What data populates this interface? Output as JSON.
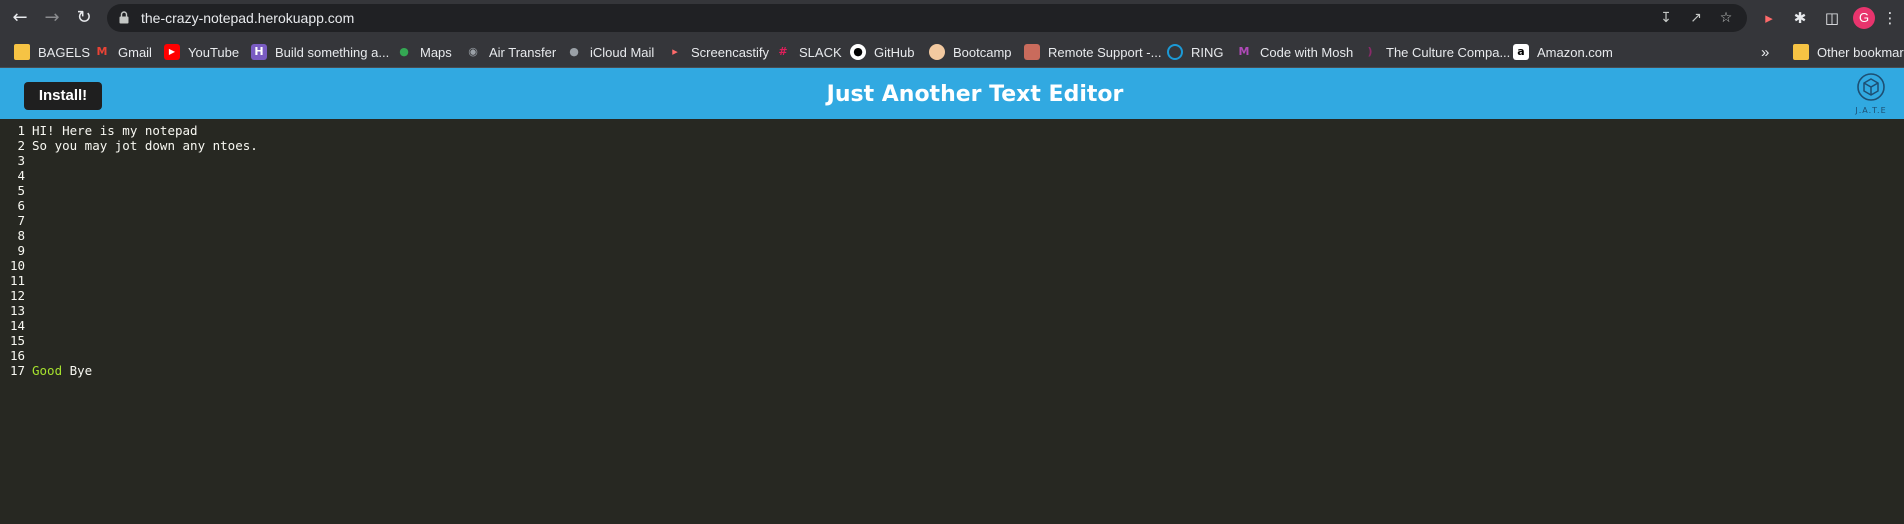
{
  "browser": {
    "url": "the-crazy-notepad.herokuapp.com",
    "avatar_letter": "G",
    "bookmarks": [
      {
        "label": "BAGELS",
        "icon": "folder-icon",
        "color": "#f6c344"
      },
      {
        "label": "Gmail",
        "icon": "gmail-icon",
        "color": "#ea4335"
      },
      {
        "label": "YouTube",
        "icon": "youtube-icon",
        "color": "#ff0000"
      },
      {
        "label": "Build something a...",
        "icon": "heroku-icon",
        "color": "#7a5cc2"
      },
      {
        "label": "Maps",
        "icon": "maps-icon",
        "color": "#34a853"
      },
      {
        "label": "Air Transfer",
        "icon": "globe-icon",
        "color": "#9aa0a6"
      },
      {
        "label": "iCloud Mail",
        "icon": "apple-icon",
        "color": "#9aa0a6"
      },
      {
        "label": "Screencastify",
        "icon": "screencastify-icon",
        "color": "#ff6a6a"
      },
      {
        "label": "SLACK",
        "icon": "slack-icon",
        "color": "#e01e5a"
      },
      {
        "label": "GitHub",
        "icon": "github-icon",
        "color": "#ffffff"
      },
      {
        "label": "Bootcamp",
        "icon": "bootcamp-icon",
        "color": "#f2c9a0"
      },
      {
        "label": "Remote Support -...",
        "icon": "remote-support-icon",
        "color": "#c96b5c"
      },
      {
        "label": "RING",
        "icon": "ring-icon",
        "color": "#1c9ad6"
      },
      {
        "label": "Code with Mosh",
        "icon": "mosh-icon",
        "color": "#b04ab8"
      },
      {
        "label": "The Culture Compa...",
        "icon": "culture-icon",
        "color": "#8a2a6a"
      },
      {
        "label": "Amazon.com",
        "icon": "amazon-icon",
        "color": "#ffffff"
      }
    ],
    "overflow_label": "»",
    "other_bookmarks": "Other bookmarks"
  },
  "app": {
    "install_label": "Install!",
    "title": "Just Another Text Editor",
    "logo_text": "J.A.T.E",
    "accent_color": "#31a9e1"
  },
  "editor": {
    "lines": [
      {
        "num": "1",
        "text": "HI! Here is my notepad"
      },
      {
        "num": "2",
        "text": "So you may jot down any ntoes."
      },
      {
        "num": "3",
        "text": ""
      },
      {
        "num": "4",
        "text": ""
      },
      {
        "num": "5",
        "text": ""
      },
      {
        "num": "6",
        "text": ""
      },
      {
        "num": "7",
        "text": ""
      },
      {
        "num": "8",
        "text": ""
      },
      {
        "num": "9",
        "text": ""
      },
      {
        "num": "10",
        "text": ""
      },
      {
        "num": "11",
        "text": ""
      },
      {
        "num": "12",
        "text": ""
      },
      {
        "num": "13",
        "text": ""
      },
      {
        "num": "14",
        "text": ""
      },
      {
        "num": "15",
        "text": ""
      },
      {
        "num": "16",
        "text": ""
      },
      {
        "num": "17",
        "keyword": "Good",
        "text": " Bye"
      }
    ]
  }
}
